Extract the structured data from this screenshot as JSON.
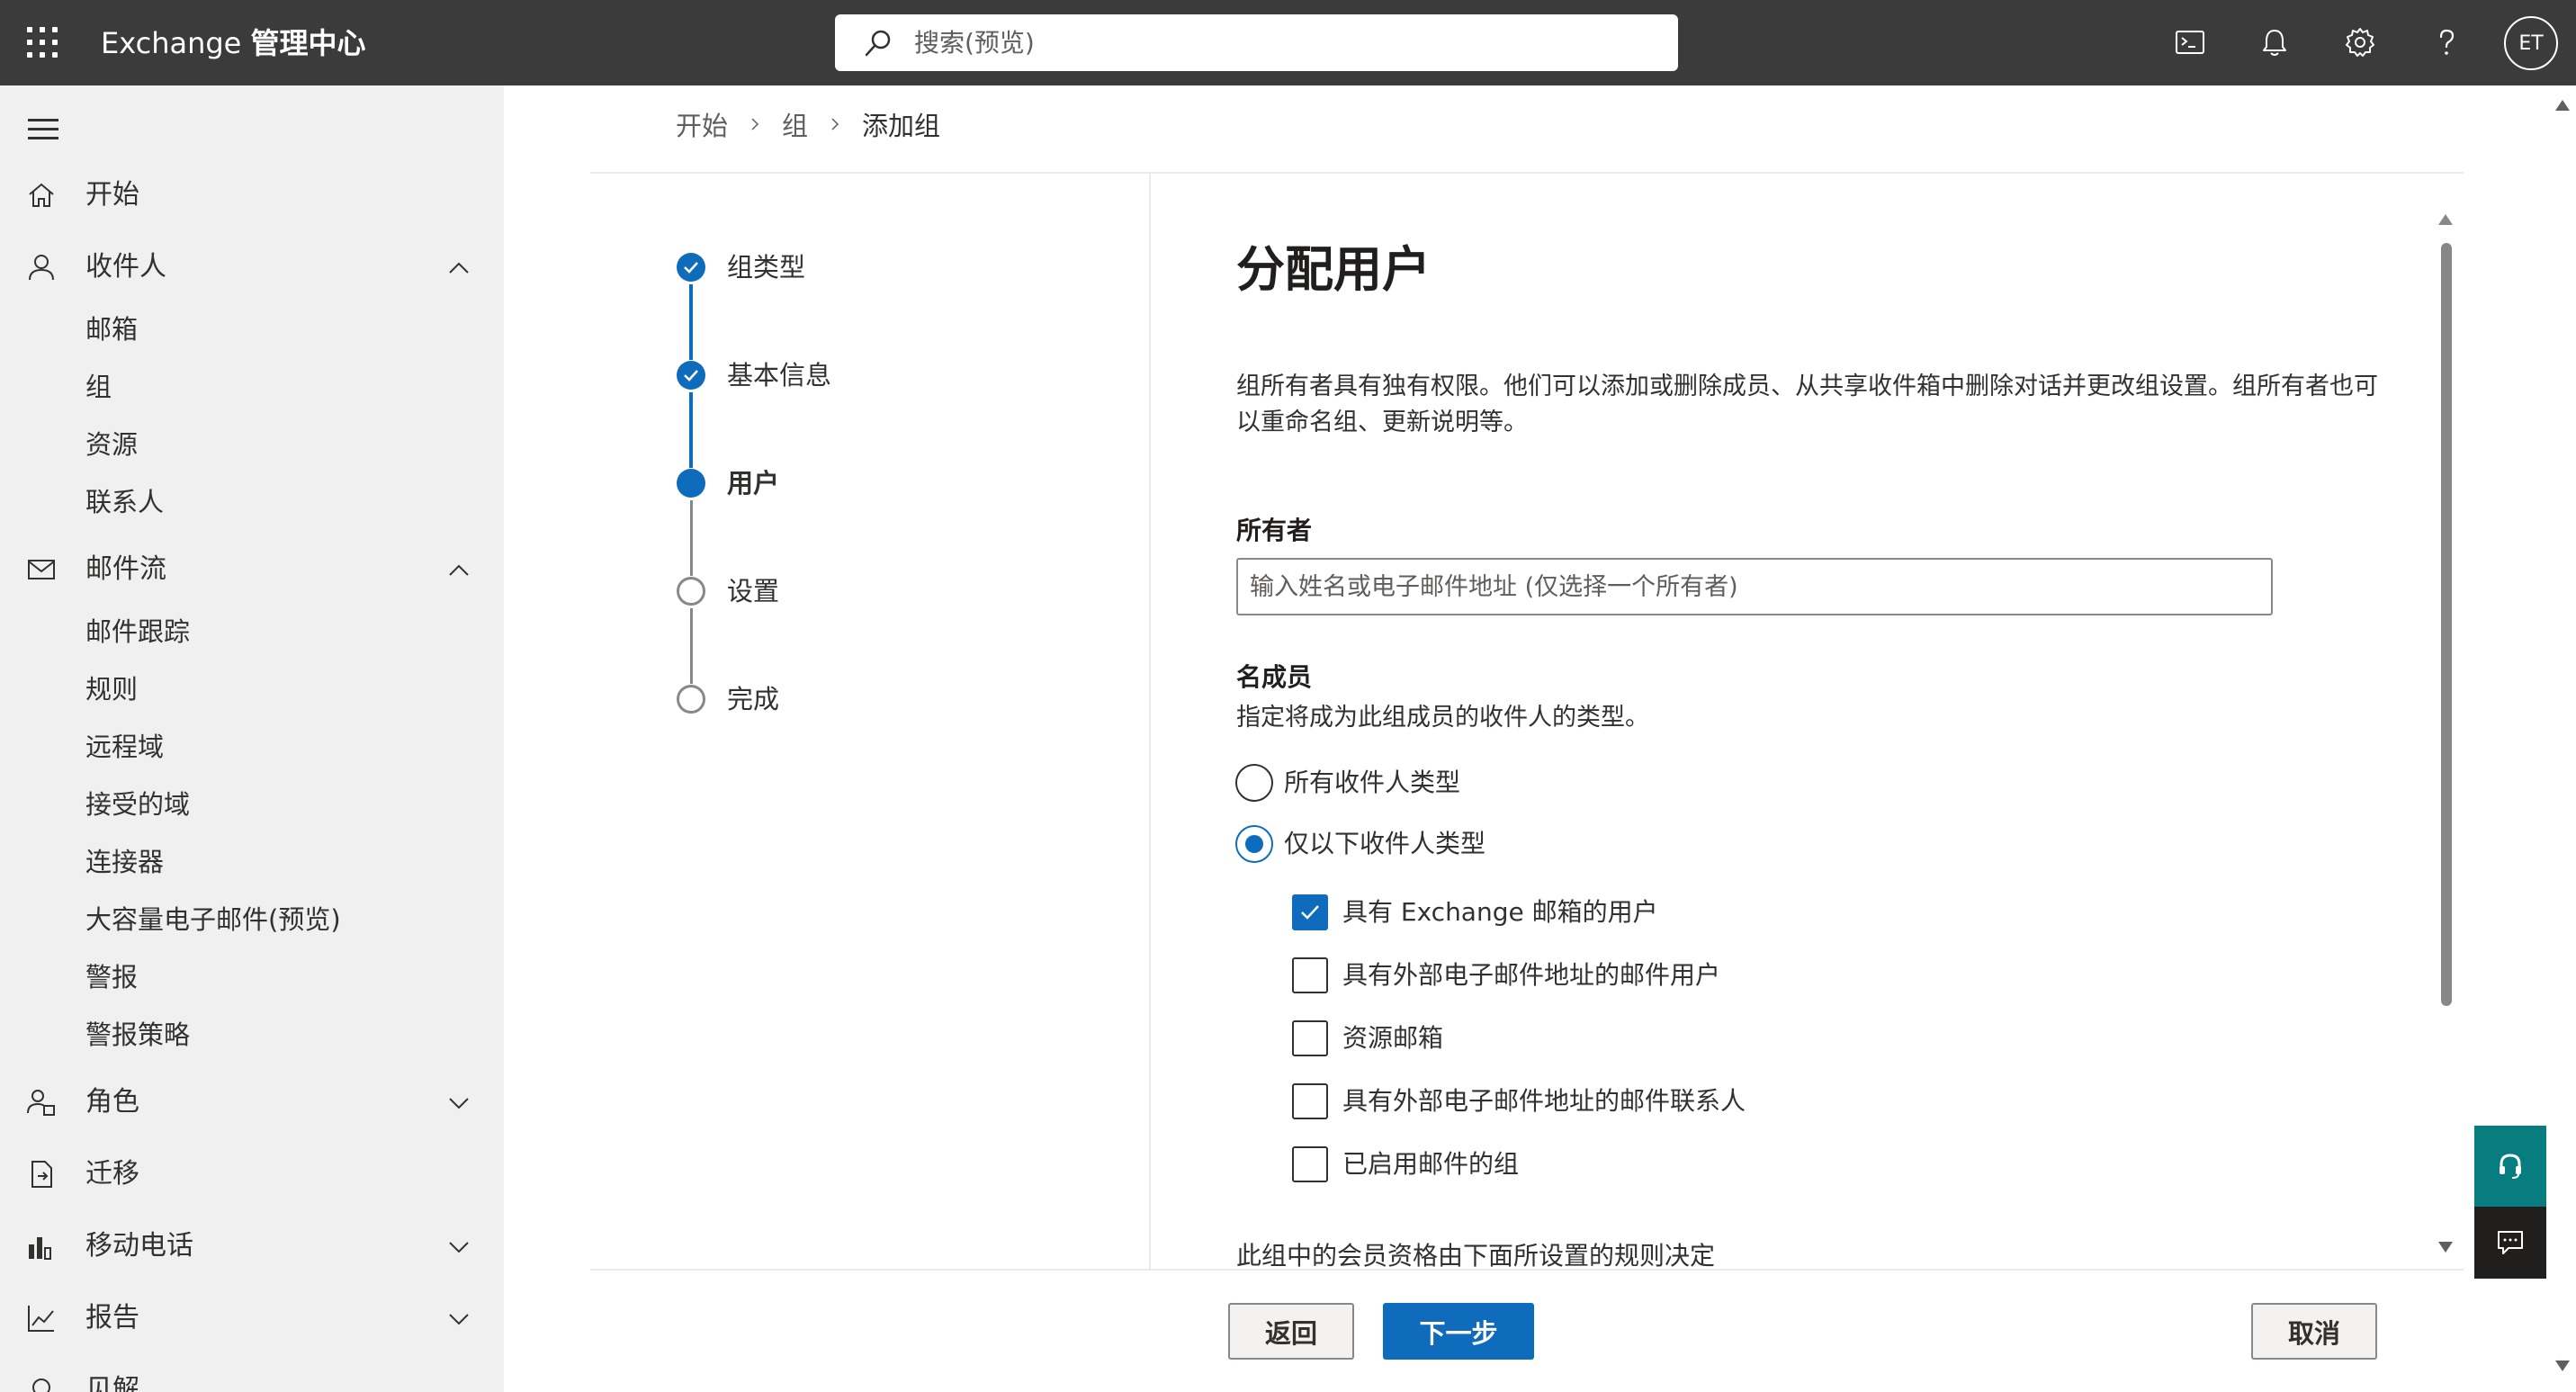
{
  "header": {
    "app_name": "Exchange",
    "app_suffix": "管理中心",
    "search_placeholder": "搜索(预览)",
    "user_initials": "ET"
  },
  "icons": {
    "app_launcher": "waffle-icon",
    "search": "search-icon",
    "shell": "terminal-icon",
    "notifications": "bell-icon",
    "settings": "gear-icon",
    "help": "question-icon"
  },
  "nav": {
    "home": "开始",
    "recipients": "收件人",
    "recipients_sub": [
      "邮箱",
      "组",
      "资源",
      "联系人"
    ],
    "mailflow": "邮件流",
    "mailflow_sub": [
      "邮件跟踪",
      "规则",
      "远程域",
      "接受的域",
      "连接器",
      "大容量电子邮件(预览)",
      "警报",
      "警报策略"
    ],
    "roles": "角色",
    "migration": "迁移",
    "mobile": "移动电话",
    "reports": "报告",
    "insights": "见解"
  },
  "breadcrumb": [
    "开始",
    "组",
    "添加组"
  ],
  "wizard": {
    "steps": [
      {
        "label": "组类型",
        "state": "done"
      },
      {
        "label": "基本信息",
        "state": "done"
      },
      {
        "label": "用户",
        "state": "current"
      },
      {
        "label": "设置",
        "state": "todo"
      },
      {
        "label": "完成",
        "state": "todo"
      }
    ]
  },
  "content": {
    "title": "分配用户",
    "description": "组所有者具有独有权限。他们可以添加或删除成员、从共享收件箱中删除对话并更改组设置。组所有者也可以重命名组、更新说明等。",
    "owner_label": "所有者",
    "owner_placeholder": "输入姓名或电子邮件地址 (仅选择一个所有者)",
    "members_label": "名成员",
    "members_desc": "指定将成为此组成员的收件人的类型。",
    "radio_all": "所有收件人类型",
    "radio_only": "仅以下收件人类型",
    "radio_selected": "only",
    "checkboxes": [
      {
        "label": "具有 Exchange 邮箱的用户",
        "checked": true
      },
      {
        "label": "具有外部电子邮件地址的邮件用户",
        "checked": false
      },
      {
        "label": "资源邮箱",
        "checked": false
      },
      {
        "label": "具有外部电子邮件地址的邮件联系人",
        "checked": false
      },
      {
        "label": "已启用邮件的组",
        "checked": false
      }
    ],
    "rules_note": "此组中的会员资格由下面所设置的规则决定"
  },
  "footer": {
    "back": "返回",
    "next": "下一步",
    "cancel": "取消"
  },
  "colors": {
    "topbar": "#3b3b3b",
    "accent": "#0f6cbd",
    "nav_bg": "#f0f0f0",
    "help_button": "#077d80"
  }
}
